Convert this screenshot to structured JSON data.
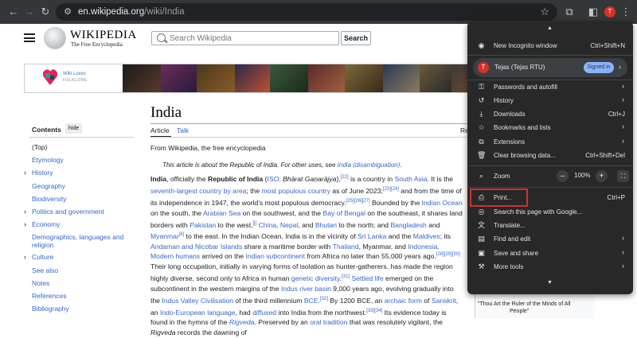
{
  "browser": {
    "url_domain": "en.wikipedia.org",
    "url_path": "/wiki/India",
    "avatar_letter": "T"
  },
  "wiki": {
    "logo_name": "WIKIPEDIA",
    "logo_tagline": "The Free Encyclopedia",
    "search_placeholder": "Search Wikipedia",
    "search_button": "Search",
    "banner_text1": "Wiki Loves",
    "banner_text2": "FOLKLORE"
  },
  "toc": {
    "title": "Contents",
    "hide_label": "hide",
    "items": [
      {
        "label": "(Top)"
      },
      {
        "label": "Etymology"
      },
      {
        "label": "History"
      },
      {
        "label": "Geography"
      },
      {
        "label": "Biodiversity"
      },
      {
        "label": "Politics and government"
      },
      {
        "label": "Economy"
      },
      {
        "label": "Demographics, languages and religion"
      },
      {
        "label": "Culture"
      },
      {
        "label": "See also"
      },
      {
        "label": "Notes"
      },
      {
        "label": "References"
      },
      {
        "label": "Bibliography"
      }
    ]
  },
  "article": {
    "title": "India",
    "tab_article": "Article",
    "tab_talk": "Talk",
    "tab_read": "Re",
    "from": "From Wikipedia, the free encyclopedia",
    "hatnote_prefix": "This article is about the Republic of India. For other uses, see ",
    "hatnote_link": "India (disambiguation)",
    "hatnote_suffix": ".",
    "quote_line1": "\"Thou Art the Ruler of the Minds of All",
    "quote_line2": "People\""
  },
  "menu": {
    "new_incognito": "New Incognito window",
    "new_incognito_shortcut": "Ctrl+Shift+N",
    "profile_name": "Tejas (Tejas RTU)",
    "profile_letter": "T",
    "signed_in": "Signed in",
    "passwords": "Passwords and autofill",
    "history": "History",
    "downloads": "Downloads",
    "downloads_shortcut": "Ctrl+J",
    "bookmarks": "Bookmarks and lists",
    "extensions": "Extensions",
    "clear_data": "Clear browsing data...",
    "clear_data_shortcut": "Ctrl+Shift+Del",
    "zoom": "Zoom",
    "zoom_minus": "–",
    "zoom_value": "100%",
    "zoom_plus": "+",
    "print": "Print...",
    "print_shortcut": "Ctrl+P",
    "search_google": "Search this page with Google...",
    "translate": "Translate...",
    "find_edit": "Find and edit",
    "save_share": "Save and share",
    "more_tools": "More tools"
  }
}
